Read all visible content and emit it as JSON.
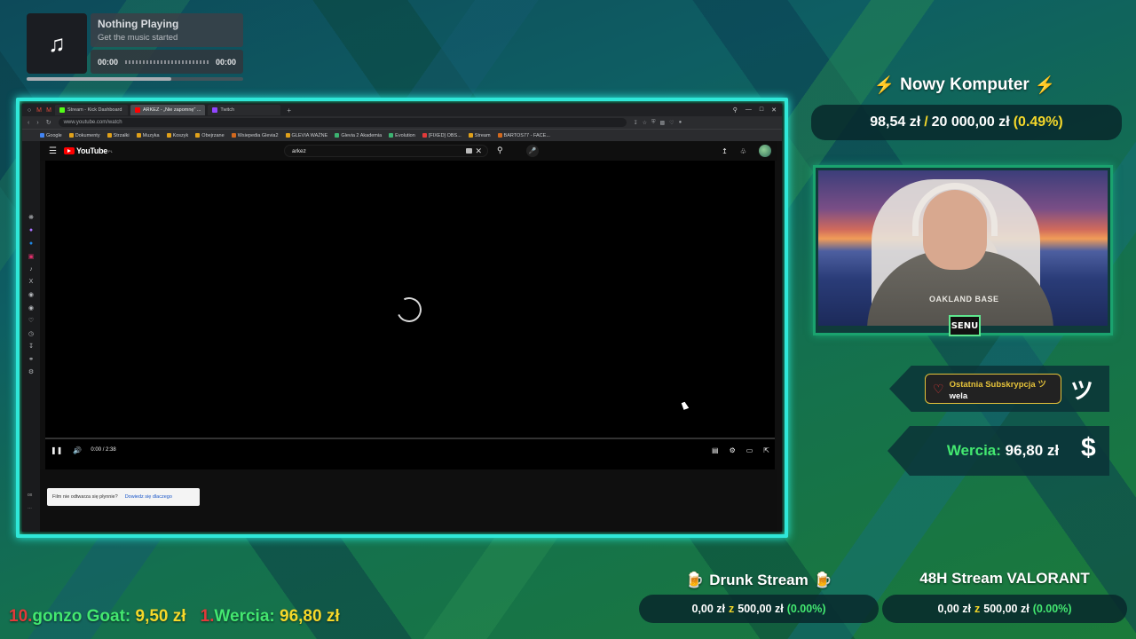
{
  "music": {
    "title": "Nothing Playing",
    "subtitle": "Get the music started",
    "time_start": "00:00",
    "time_end": "00:00",
    "note_icon": "music-note-icon"
  },
  "browser": {
    "tabs": [
      {
        "label": "Stream - Kick Dashboard",
        "color": "#53fc18"
      },
      {
        "label": "ARKEZ - „Nie zapomnę” ...",
        "color": "#ff0000"
      },
      {
        "label": "Twitch",
        "color": "#9146ff"
      }
    ],
    "url": "www.youtube.com/watch",
    "bookmarks": [
      "Google",
      "Dokumenty",
      "Strzałki",
      "Muzyka",
      "Koszyk",
      "Obejrzane",
      "Wsiepedia Glevia2",
      "GLEVIA WAŻNE",
      "Glevia 2 Akademia",
      "Evolution",
      "[FIXED] OBS...",
      "Stream",
      "BARTOS77 - FACE..."
    ]
  },
  "youtube": {
    "logo": "YouTube",
    "logo_region": "PL",
    "search_value": "arkez",
    "time": "0:00 / 2:38",
    "tip_text": "Film nie odtwarza się płynnie?",
    "tip_link": "Dowiedz się dlaczego"
  },
  "goal_main": {
    "title": "Nowy Komputer",
    "current": "98,54 zł",
    "separator": "/",
    "target": "20 000,00 zł",
    "percent": "(0.49%)"
  },
  "webcam": {
    "shirt_text": "OAKLAND BASE",
    "logo": "SENU"
  },
  "subscription": {
    "label": "Ostatnia Subskrypcja ツ",
    "name": "wela",
    "tsu": "ツ"
  },
  "donation": {
    "name": "Wercia",
    "amount": "96,80 zł",
    "symbol": "$"
  },
  "goal_drunk": {
    "title": "Drunk Stream",
    "current": "0,00 zł",
    "z": "z",
    "target": "500,00 zł",
    "percent": "(0.00%)"
  },
  "goal_48h": {
    "title": "48H Stream VALORANT",
    "current": "0,00 zł",
    "z": "z",
    "target": "500,00 zł",
    "percent": "(0.00%)"
  },
  "leaderboard": [
    {
      "rank": "10.",
      "name": "gonzo Goat",
      "amount": "9,50 zł"
    },
    {
      "rank": "1.",
      "name": "Wercia",
      "amount": "96,80 zł"
    }
  ],
  "colors": {
    "frame_accent": "#2fe7d8",
    "highlight_yellow": "#f5d82a",
    "percent_green": "#43e870",
    "rank_red": "#e23a3a"
  }
}
